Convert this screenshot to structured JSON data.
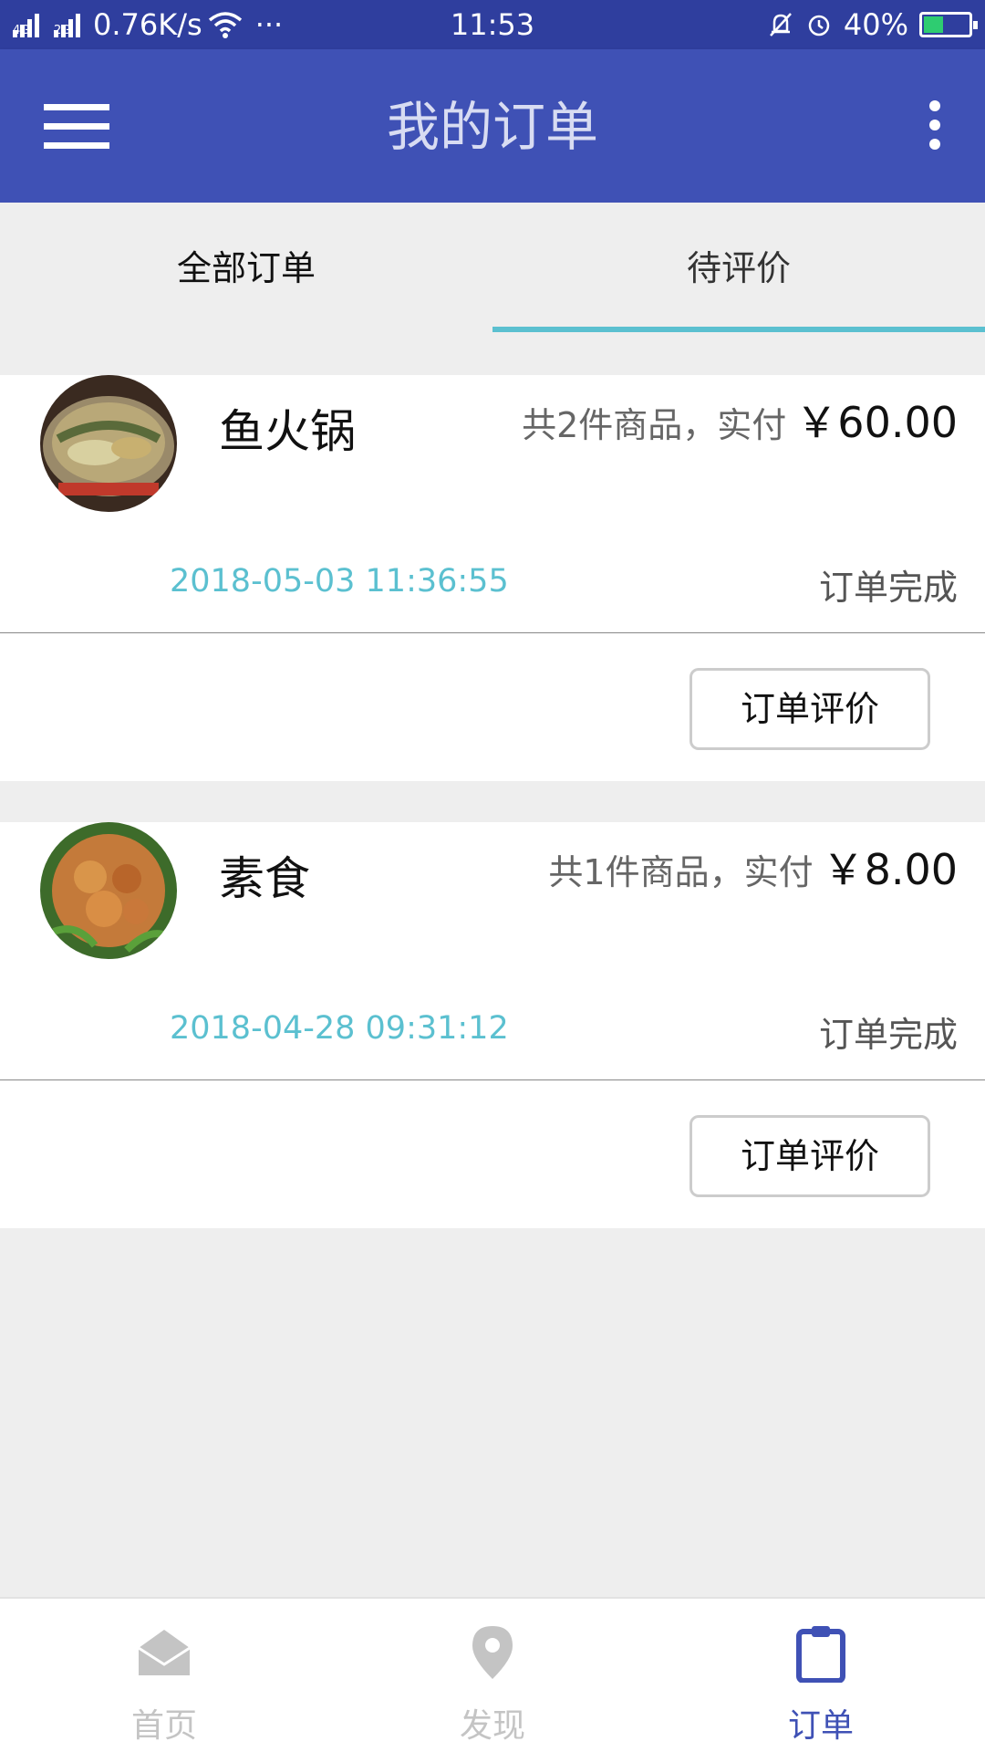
{
  "status_bar": {
    "network_1": "4G",
    "network_2": "2G",
    "speed": "0.76K/s",
    "dots": "···",
    "time": "11:53",
    "battery": "40%",
    "battery_level": 0.4
  },
  "app_bar": {
    "title": "我的订单"
  },
  "tabs": [
    {
      "label": "全部订单",
      "selected": false
    },
    {
      "label": "待评价",
      "selected": true
    }
  ],
  "orders": [
    {
      "name": "鱼火锅",
      "summary": "共2件商品，实付",
      "price": "￥60.00",
      "time": "2018-05-03 11:36:55",
      "status": "订单完成",
      "action": "订单评价"
    },
    {
      "name": "素食",
      "summary": "共1件商品，实付",
      "price": "￥8.00",
      "time": "2018-04-28 09:31:12",
      "status": "订单完成",
      "action": "订单评价"
    }
  ],
  "bottom_nav": [
    {
      "label": "首页",
      "icon": "envelope-open-icon",
      "active": false
    },
    {
      "label": "发现",
      "icon": "location-pin-icon",
      "active": false
    },
    {
      "label": "订单",
      "icon": "clipboard-icon",
      "active": true
    }
  ],
  "colors": {
    "primary": "#3f51b5",
    "status_bar": "#2f3e9e",
    "accent": "#5bc0d0",
    "background": "#eeeeee"
  }
}
